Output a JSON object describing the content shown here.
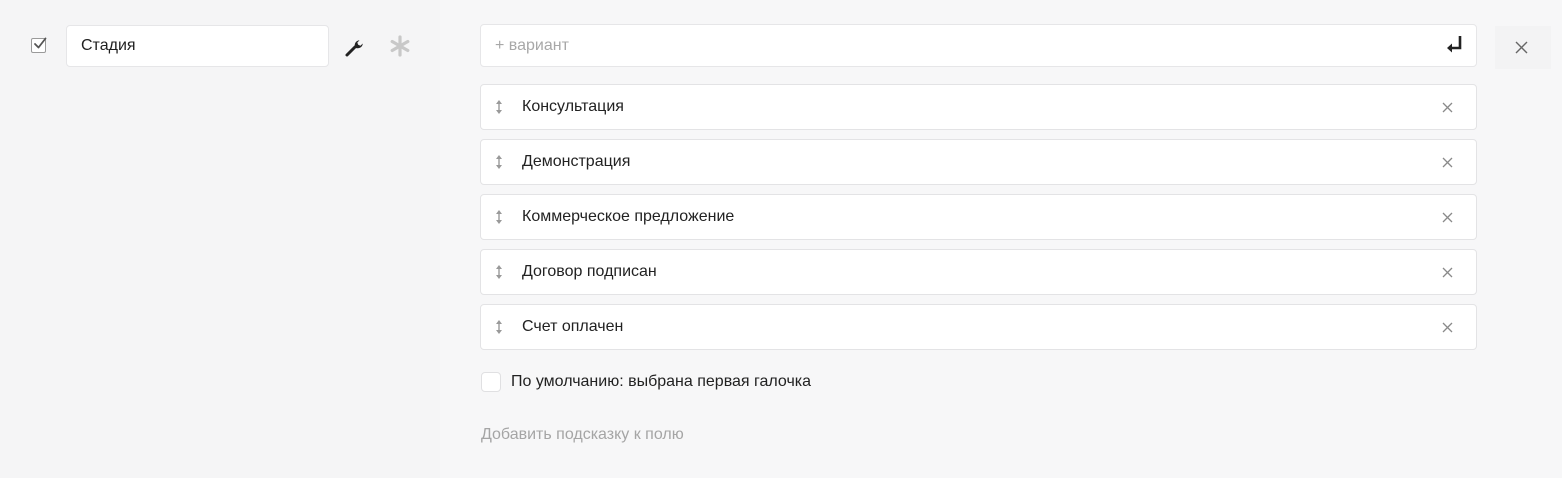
{
  "field": {
    "name_value": "Стадия",
    "required_checkbox_checked": true,
    "icons": [
      "check-icon",
      "wrench-icon",
      "asterisk-icon"
    ]
  },
  "variant_input": {
    "placeholder": "+ вариант",
    "enter_icon": "enter-icon"
  },
  "options": [
    {
      "label": "Консультация"
    },
    {
      "label": "Демонстрация"
    },
    {
      "label": "Коммерческое предложение"
    },
    {
      "label": "Договор подписан"
    },
    {
      "label": "Счет оплачен"
    }
  ],
  "default_option": {
    "label": "По умолчанию: выбрана первая галочка",
    "checked": false
  },
  "hint_link": "Добавить подсказку к полю",
  "colors": {
    "background": "#f5f5f6",
    "input_border": "#e6e6e8",
    "icon_dark": "#222222",
    "icon_light": "#c8c8c8",
    "muted_text": "#a5a5a5"
  }
}
